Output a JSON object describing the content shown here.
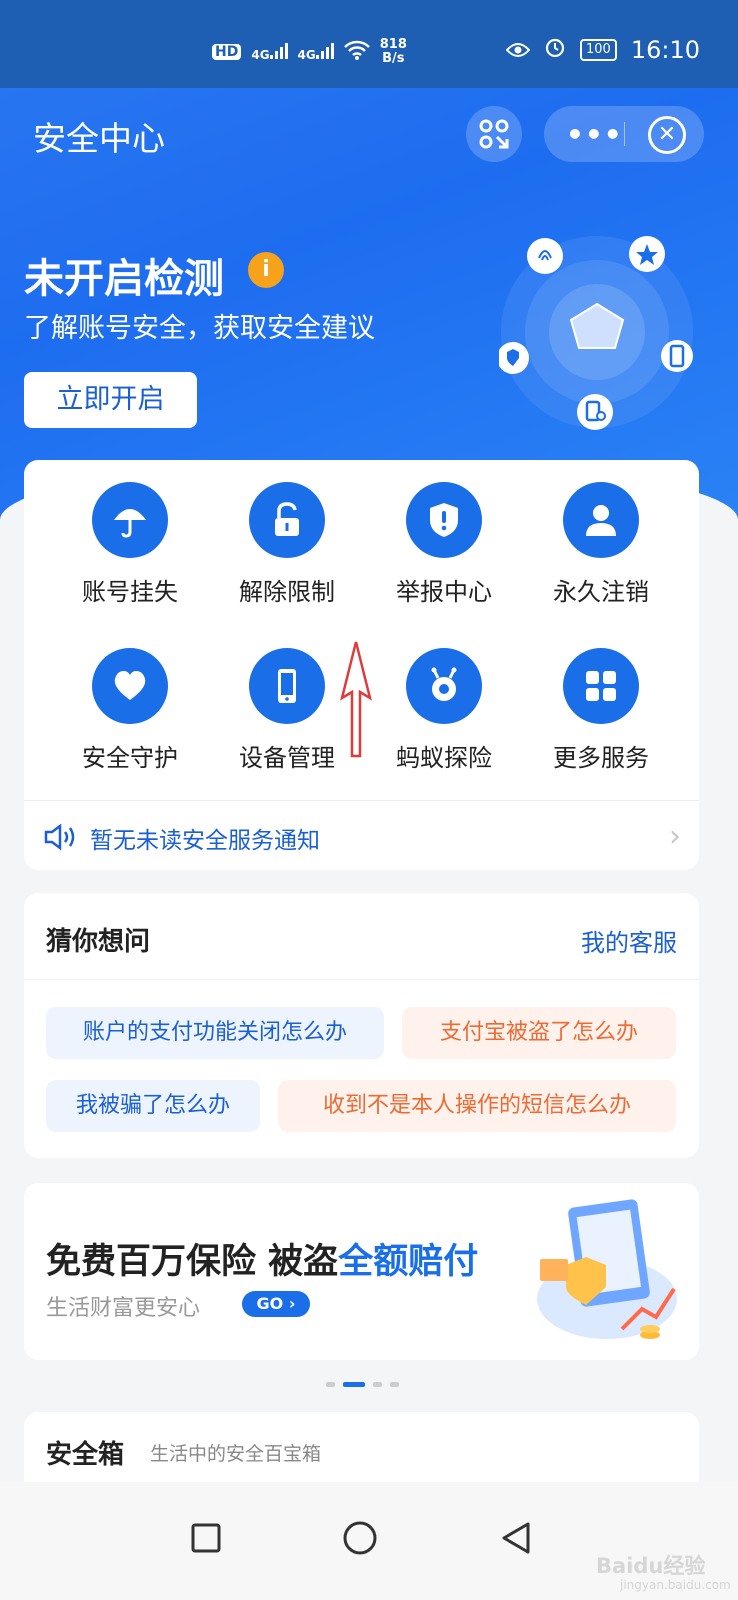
{
  "status_bar": {
    "hd": "HD",
    "signal1": "4G",
    "signal2": "4G",
    "net_speed_value": "818",
    "net_speed_unit": "B/s",
    "battery": "100",
    "time": "16:10"
  },
  "header": {
    "title": "安全中心",
    "more_label": "•••",
    "close_label": "✕"
  },
  "detection": {
    "title": "未开启检测",
    "info_badge": "i",
    "subtitle": "了解账号安全，获取安全建议",
    "button_label": "立即开启"
  },
  "services": [
    {
      "label": "账号挂失",
      "icon": "umbrella-icon"
    },
    {
      "label": "解除限制",
      "icon": "unlock-icon"
    },
    {
      "label": "举报中心",
      "icon": "shield-alert-icon"
    },
    {
      "label": "永久注销",
      "icon": "user-icon"
    },
    {
      "label": "安全守护",
      "icon": "heart-icon"
    },
    {
      "label": "设备管理",
      "icon": "phone-icon"
    },
    {
      "label": "蚂蚁探险",
      "icon": "ant-icon"
    },
    {
      "label": "更多服务",
      "icon": "grid-icon"
    }
  ],
  "notice": {
    "text": "暂无未读安全服务通知",
    "chevron": "›"
  },
  "faq": {
    "title": "猜你想问",
    "link": "我的客服",
    "chips": [
      {
        "text": "账户的支付功能关闭怎么办",
        "color": "blue"
      },
      {
        "text": "支付宝被盗了怎么办",
        "color": "orange"
      },
      {
        "text": "我被骗了怎么办",
        "color": "blue"
      },
      {
        "text": "收到不是本人操作的短信怎么办",
        "color": "orange"
      }
    ]
  },
  "insurance": {
    "title_part1": "免费百万保险 被盗",
    "title_highlight": "全额赔付",
    "subtitle": "生活财富更安心",
    "go_label": "GO ›"
  },
  "safebox": {
    "title": "安全箱",
    "subtitle": "生活中的安全百宝箱"
  },
  "watermark": {
    "brand": "Baidu经验",
    "url": "jingyan.baidu.com"
  },
  "colors": {
    "primary": "#1a6fe8",
    "header_bg": "#2a78f0",
    "orange": "#ee6a32",
    "info": "#f7a21b"
  }
}
